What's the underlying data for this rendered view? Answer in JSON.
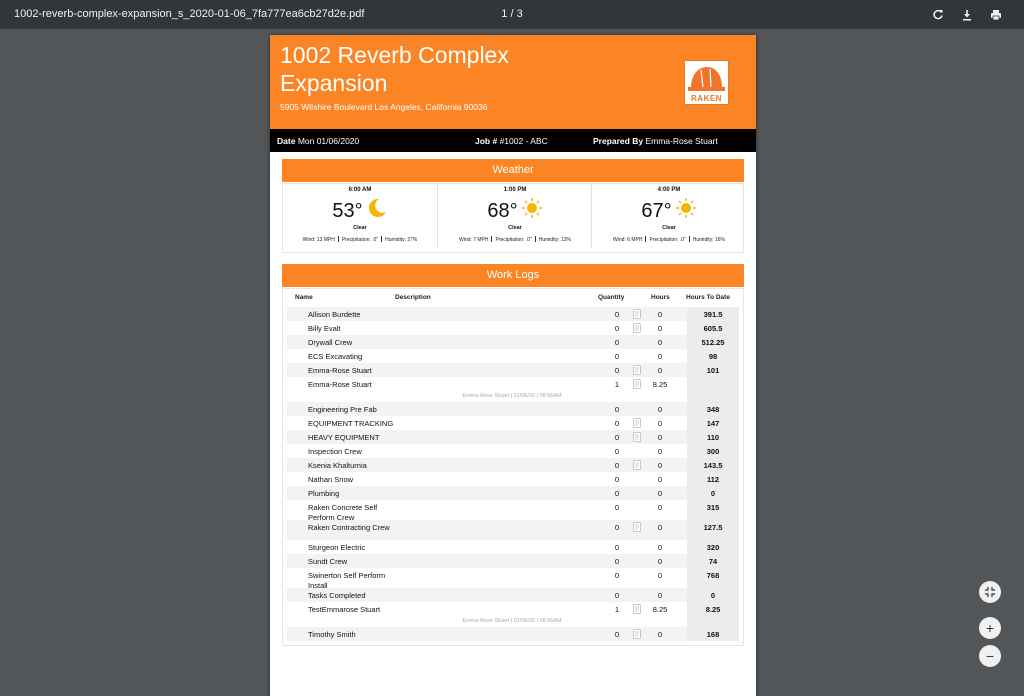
{
  "toolbar": {
    "filename": "1002-reverb-complex-expansion_s_2020-01-06_7fa777ea6cb27d2e.pdf",
    "page_indicator": "1 / 3"
  },
  "report": {
    "title": "1002 Reverb Complex Expansion",
    "address": "5905 Wilshire Boulevard Los Angeles, California 90036",
    "logo_text": "RAKEN",
    "date_label": "Date",
    "date_value": "Mon 01/06/2020",
    "job_label": "Job #",
    "job_value": "#1002 - ABC",
    "prepared_label": "Prepared By",
    "prepared_value": "Emma-Rose Stuart"
  },
  "weather": {
    "heading": "Weather",
    "entries": [
      {
        "time": "6:00 AM",
        "temp": "53°",
        "icon": "moon-icon",
        "condition": "Clear",
        "wind": "Wind: 13 MPH",
        "precip": "Precipitation: .0\"",
        "humidity": "Humidity: 27%"
      },
      {
        "time": "1:00 PM",
        "temp": "68°",
        "icon": "sun-icon",
        "condition": "Clear",
        "wind": "Wind: 7 MPH",
        "precip": "Precipitation: .0\"",
        "humidity": "Humidity: 13%"
      },
      {
        "time": "4:00 PM",
        "temp": "67°",
        "icon": "sun-icon",
        "condition": "Clear",
        "wind": "Wind: 6 MPH",
        "precip": "Precipitation: .0\"",
        "humidity": "Humidity: 16%"
      }
    ]
  },
  "worklogs": {
    "heading": "Work Logs",
    "columns": {
      "name": "Name",
      "description": "Description",
      "quantity": "Quantity",
      "hours": "Hours",
      "hours_to_date": "Hours To Date"
    },
    "rows": [
      {
        "name": "Allison Burdette",
        "qty": "0",
        "hours": "0",
        "htd": "391.5",
        "note": true,
        "sub": ""
      },
      {
        "name": "Billy Evalt",
        "qty": "0",
        "hours": "0",
        "htd": "605.5",
        "note": true,
        "sub": ""
      },
      {
        "name": "Drywall Crew",
        "qty": "0",
        "hours": "0",
        "htd": "512.25",
        "note": false,
        "sub": ""
      },
      {
        "name": "ECS Excavating",
        "qty": "0",
        "hours": "0",
        "htd": "98",
        "note": false,
        "sub": ""
      },
      {
        "name": "Emma-Rose Stuart",
        "qty": "0",
        "hours": "0",
        "htd": "101",
        "note": true,
        "sub": ""
      },
      {
        "name": "Emma-Rose Stuart",
        "qty": "1",
        "hours": "8.25",
        "htd": "",
        "note": true,
        "sub": "Emma-Rose Stuart | 01/06/20 | 08:56AM"
      },
      {
        "name": "Engineering Pre Fab",
        "qty": "0",
        "hours": "0",
        "htd": "348",
        "note": false,
        "sub": ""
      },
      {
        "name": "EQUIPMENT TRACKING",
        "qty": "0",
        "hours": "0",
        "htd": "147",
        "note": true,
        "sub": ""
      },
      {
        "name": "HEAVY EQUIPMENT",
        "qty": "0",
        "hours": "0",
        "htd": "110",
        "note": true,
        "sub": ""
      },
      {
        "name": "Inspection Crew",
        "qty": "0",
        "hours": "0",
        "htd": "300",
        "note": false,
        "sub": ""
      },
      {
        "name": "Ksenia Khalturnia",
        "qty": "0",
        "hours": "0",
        "htd": "143.5",
        "note": true,
        "sub": ""
      },
      {
        "name": "Nathan Snow",
        "qty": "0",
        "hours": "0",
        "htd": "112",
        "note": false,
        "sub": ""
      },
      {
        "name": "Plumbing",
        "qty": "0",
        "hours": "0",
        "htd": "0",
        "note": false,
        "sub": ""
      },
      {
        "name": "Raken Concrete Self Perform Crew",
        "qty": "0",
        "hours": "0",
        "htd": "315",
        "note": false,
        "sub": ""
      },
      {
        "name": "Raken Contracting Crew",
        "qty": "0",
        "hours": "0",
        "htd": "127.5",
        "note": true,
        "sub": ""
      },
      {
        "name": "Sturgeon Electric",
        "qty": "0",
        "hours": "0",
        "htd": "320",
        "note": false,
        "sub": ""
      },
      {
        "name": "Sundt Crew",
        "qty": "0",
        "hours": "0",
        "htd": "74",
        "note": false,
        "sub": ""
      },
      {
        "name": "Swinerton Self Perform Install",
        "qty": "0",
        "hours": "0",
        "htd": "768",
        "note": false,
        "sub": ""
      },
      {
        "name": "Tasks Completed",
        "qty": "0",
        "hours": "0",
        "htd": "0",
        "note": false,
        "sub": ""
      },
      {
        "name": "TestEmmarose Stuart",
        "qty": "1",
        "hours": "8.25",
        "htd": "8.25",
        "note": true,
        "sub": "Emma-Rose Stuart | 01/06/20 | 08:56AM"
      },
      {
        "name": "Timothy Smith",
        "qty": "0",
        "hours": "0",
        "htd": "168",
        "note": true,
        "sub": ""
      }
    ]
  },
  "colors": {
    "brand_orange": "#fb8524",
    "toolbar": "#323639",
    "viewer_bg": "#525659"
  }
}
